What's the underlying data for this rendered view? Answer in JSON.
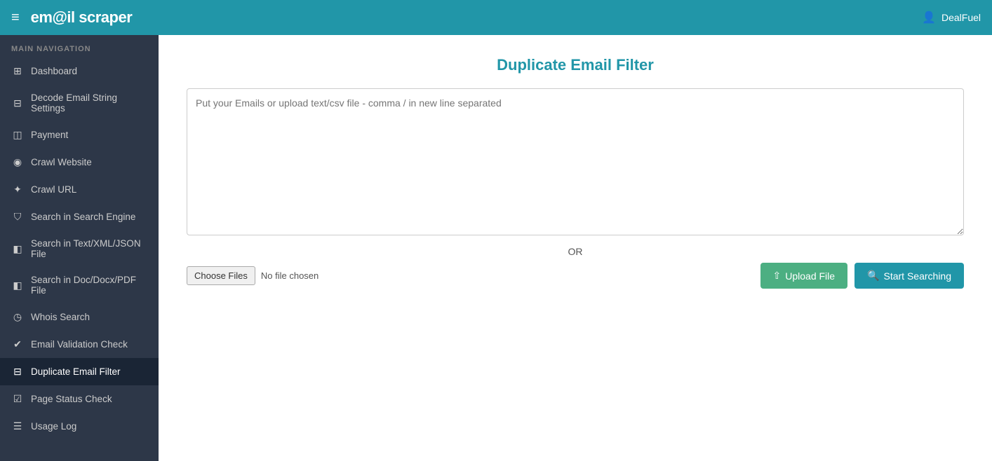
{
  "header": {
    "logo": "em@il scraper",
    "hamburger_icon": "≡",
    "user_icon": "👤",
    "username": "DealFuel"
  },
  "sidebar": {
    "section_label": "MAIN NAVIGATION",
    "items": [
      {
        "id": "dashboard",
        "label": "Dashboard",
        "icon": "⊞"
      },
      {
        "id": "decode-email",
        "label": "Decode Email String Settings",
        "icon": "⊟"
      },
      {
        "id": "payment",
        "label": "Payment",
        "icon": "💳"
      },
      {
        "id": "crawl-website",
        "label": "Crawl Website",
        "icon": "🌐"
      },
      {
        "id": "crawl-url",
        "label": "Crawl URL",
        "icon": "⚙"
      },
      {
        "id": "search-engine",
        "label": "Search in Search Engine",
        "icon": "🎒"
      },
      {
        "id": "search-text",
        "label": "Search in Text/XML/JSON File",
        "icon": "📄"
      },
      {
        "id": "search-doc",
        "label": "Search in Doc/Docx/PDF File",
        "icon": "📄"
      },
      {
        "id": "whois",
        "label": "Whois Search",
        "icon": "👤"
      },
      {
        "id": "email-validation",
        "label": "Email Validation Check",
        "icon": "✔"
      },
      {
        "id": "duplicate-filter",
        "label": "Duplicate Email Filter",
        "icon": "⊟",
        "active": true
      },
      {
        "id": "page-status",
        "label": "Page Status Check",
        "icon": "☑"
      },
      {
        "id": "usage-log",
        "label": "Usage Log",
        "icon": "☰"
      }
    ]
  },
  "main": {
    "page_title": "Duplicate Email Filter",
    "textarea_placeholder": "Put your Emails or upload text/csv file - comma / in new line separated",
    "or_label": "OR",
    "choose_label": "Choose Files",
    "no_file_label": "No file chosen",
    "upload_button": "Upload File",
    "start_button": "Start Searching",
    "upload_icon": "⬆",
    "search_icon": "🔍"
  }
}
